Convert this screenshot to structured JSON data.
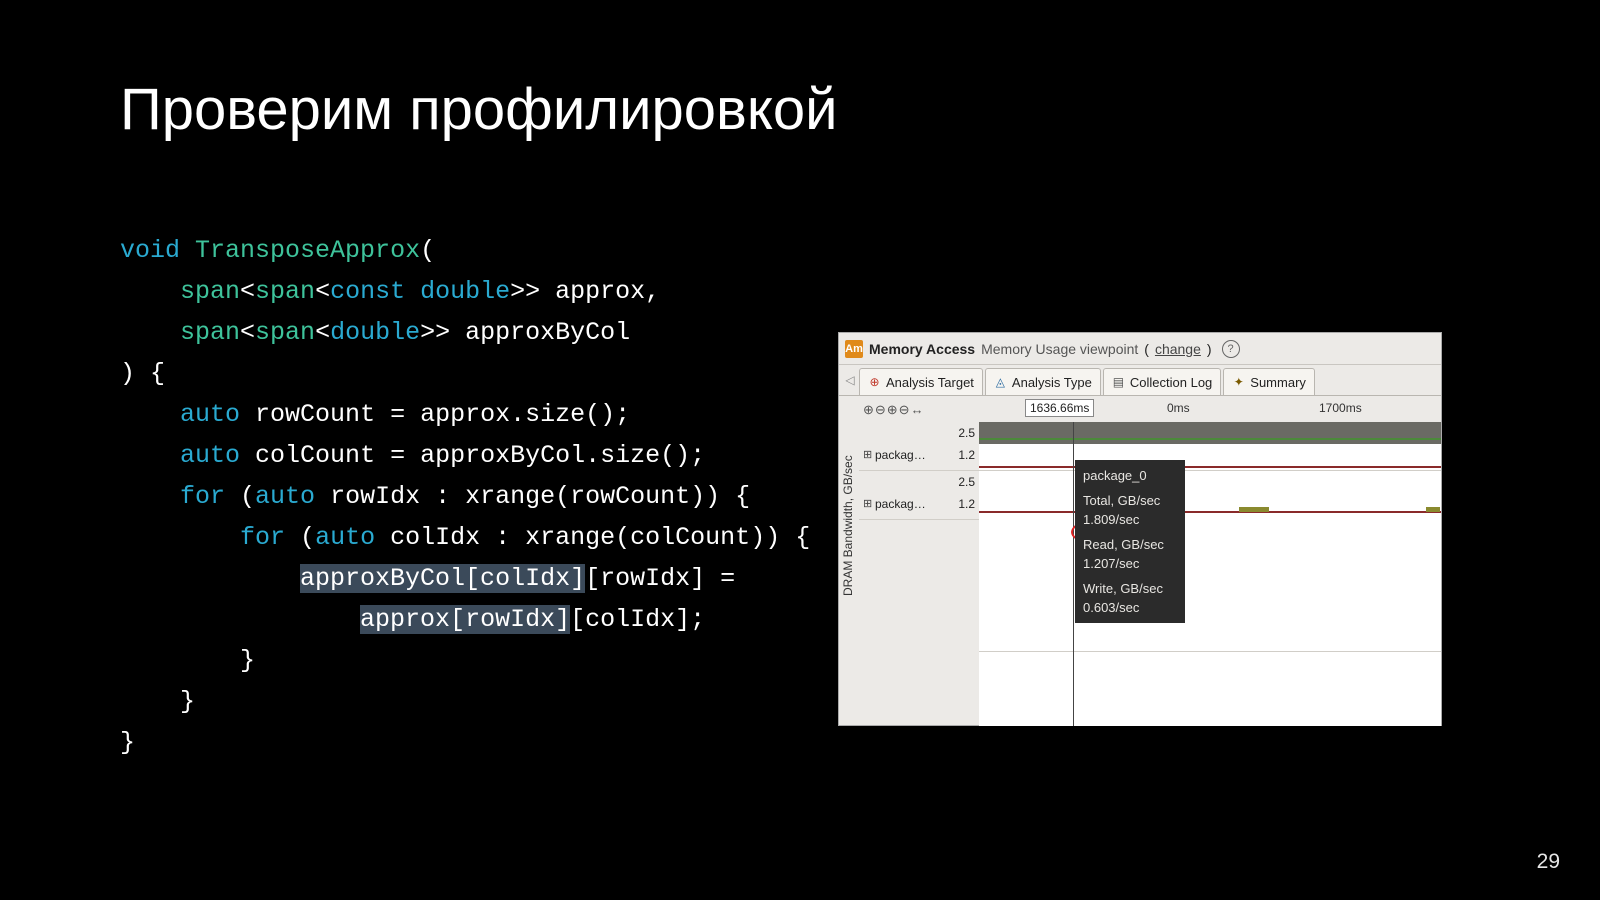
{
  "title": "Проверим профилировкой",
  "code": {
    "kw_void": "void",
    "fn": "TransposeApprox",
    "ty_span": "span",
    "kw_const": "const",
    "kw_double": "double",
    "p1": "approx",
    "p2": "approxByCol",
    "kw_auto": "auto",
    "v_rowCount": "rowCount",
    "v_colCount": "colCount",
    "m_size": "size",
    "kw_for": "for",
    "v_rowIdx": "rowIdx",
    "v_colIdx": "colIdx",
    "fn_xrange": "xrange",
    "hl1": "approxByCol[colIdx]",
    "t1": "[rowIdx] =",
    "hl2": "approx[rowIdx]",
    "t2": "[colIdx];"
  },
  "profiler": {
    "icon_letter": "Am",
    "title_strong": "Memory Access",
    "title_sub": "Memory Usage viewpoint",
    "change": "change",
    "tabs": {
      "t1": "Analysis Target",
      "t2": "Analysis Type",
      "t3": "Collection Log",
      "t4": "Summary"
    },
    "time_cursor": "1636.66ms",
    "tick_after": "0ms",
    "tick_1700": "1700ms",
    "axis_label": "DRAM Bandwidth, GB/sec",
    "row_name": "packag…",
    "scale_hi": "2.5",
    "scale_lo": "1.2",
    "tooltip": {
      "name": "package_0",
      "total_l": "Total, GB/sec",
      "total_v": "1.809/sec",
      "read_l": "Read, GB/sec",
      "read_v": "1.207/sec",
      "write_l": "Write, GB/sec",
      "write_v": "0.603/sec"
    }
  },
  "slide_number": "29"
}
